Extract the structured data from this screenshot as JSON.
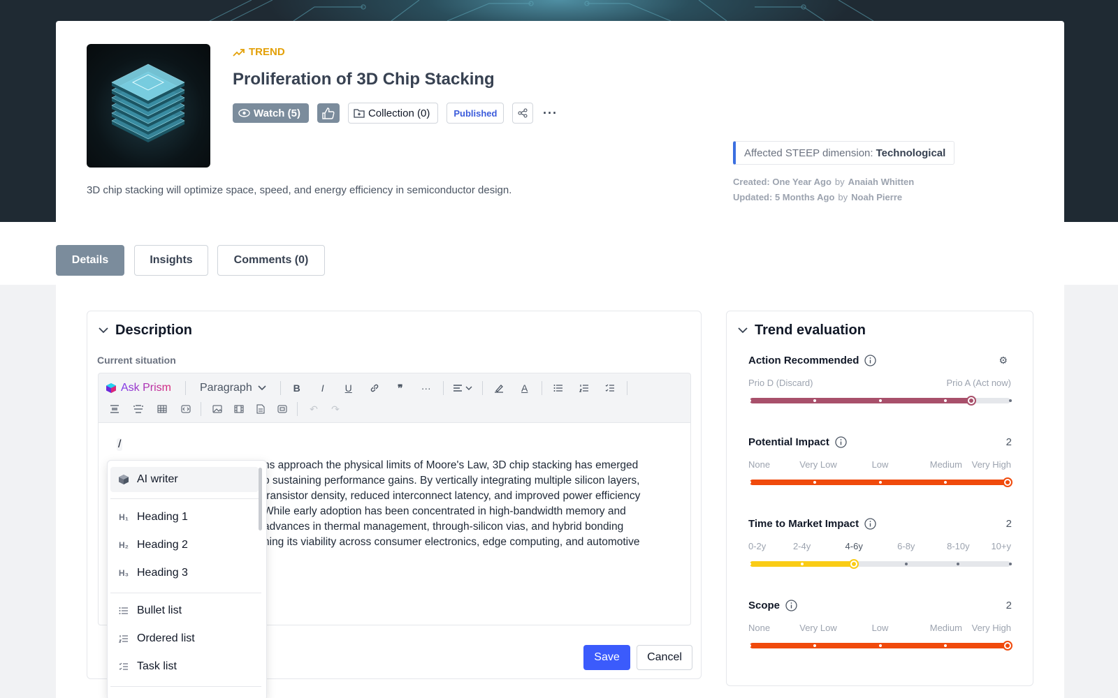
{
  "header": {
    "type_label": "TREND",
    "title": "Proliferation of 3D Chip Stacking",
    "watch_label": "Watch (5)",
    "collection_label": "Collection (0)",
    "status_badge": "Published",
    "summary": "3D chip stacking will optimize space, speed, and energy efficiency in semiconductor design.",
    "steep_prefix": "Affected STEEP dimension:",
    "steep_value": "Technological",
    "created_label": "Created: One Year Ago",
    "created_by": "Anaiah Whitten",
    "updated_label": "Updated: 5 Months Ago",
    "updated_by": "Noah Pierre",
    "by_word": "by"
  },
  "tabs": [
    {
      "label": "Details",
      "active": true
    },
    {
      "label": "Insights",
      "active": false
    },
    {
      "label": "Comments (0)",
      "active": false
    }
  ],
  "description": {
    "heading": "Description",
    "sub_label": "Current situation",
    "ask_label": "Ask Prism",
    "paragraph_select": "Paragraph",
    "editor_input": "/",
    "body_lines": [
      "ns approach the physical limits of Moore's Law, 3D chip stacking has emerged",
      "o sustaining performance gains. By vertically integrating multiple silicon layers,",
      " transistor density, reduced interconnect latency, and improved power efficiency",
      "While early adoption has been concentrated in high-bandwidth memory and",
      " advances in thermal management, through-silicon vias, and hybrid bonding",
      "ning its viability across consumer electronics, edge computing, and automotive"
    ],
    "save_label": "Save",
    "cancel_label": "Cancel"
  },
  "slash_menu": {
    "items": [
      {
        "label": "AI writer",
        "icon": "cube-icon"
      },
      {
        "label": "Heading 1",
        "icon": "heading-1-icon",
        "glyph": "H₁"
      },
      {
        "label": "Heading 2",
        "icon": "heading-2-icon",
        "glyph": "H₂"
      },
      {
        "label": "Heading 3",
        "icon": "heading-3-icon",
        "glyph": "H₃"
      },
      {
        "label": "Bullet list",
        "icon": "bullet-list-icon"
      },
      {
        "label": "Ordered list",
        "icon": "ordered-list-icon"
      },
      {
        "label": "Task list",
        "icon": "task-list-icon"
      }
    ]
  },
  "evaluation": {
    "heading": "Trend evaluation",
    "metrics": [
      {
        "title": "Action Recommended",
        "value": "",
        "labels": [
          "Prio D (Discard)",
          "Prio A (Act now)"
        ],
        "level": 0.85,
        "color": "#a8506b"
      },
      {
        "title": "Potential Impact",
        "value": "2",
        "labels": [
          "None",
          "Very Low",
          "Low",
          "Medium",
          "Very High"
        ],
        "level": 1.0,
        "color": "#f04a0c"
      },
      {
        "title": "Time to Market Impact",
        "value": "2",
        "labels": [
          "0-2y",
          "2-4y",
          "4-6y",
          "6-8y",
          "8-10y",
          "10+y"
        ],
        "level": 0.4,
        "selected": 2,
        "color": "#facc15"
      },
      {
        "title": "Scope",
        "value": "2",
        "labels": [
          "None",
          "Very Low",
          "Low",
          "Medium",
          "Very High"
        ],
        "level": 1.0,
        "color": "#f04a0c"
      }
    ]
  },
  "colors": {
    "accent": "#3b5bfc",
    "trend_tag": "#e3a008",
    "tab_active": "#7b8c9c",
    "published": "#3b5bdb",
    "steep_border": "#3b6fe0"
  }
}
